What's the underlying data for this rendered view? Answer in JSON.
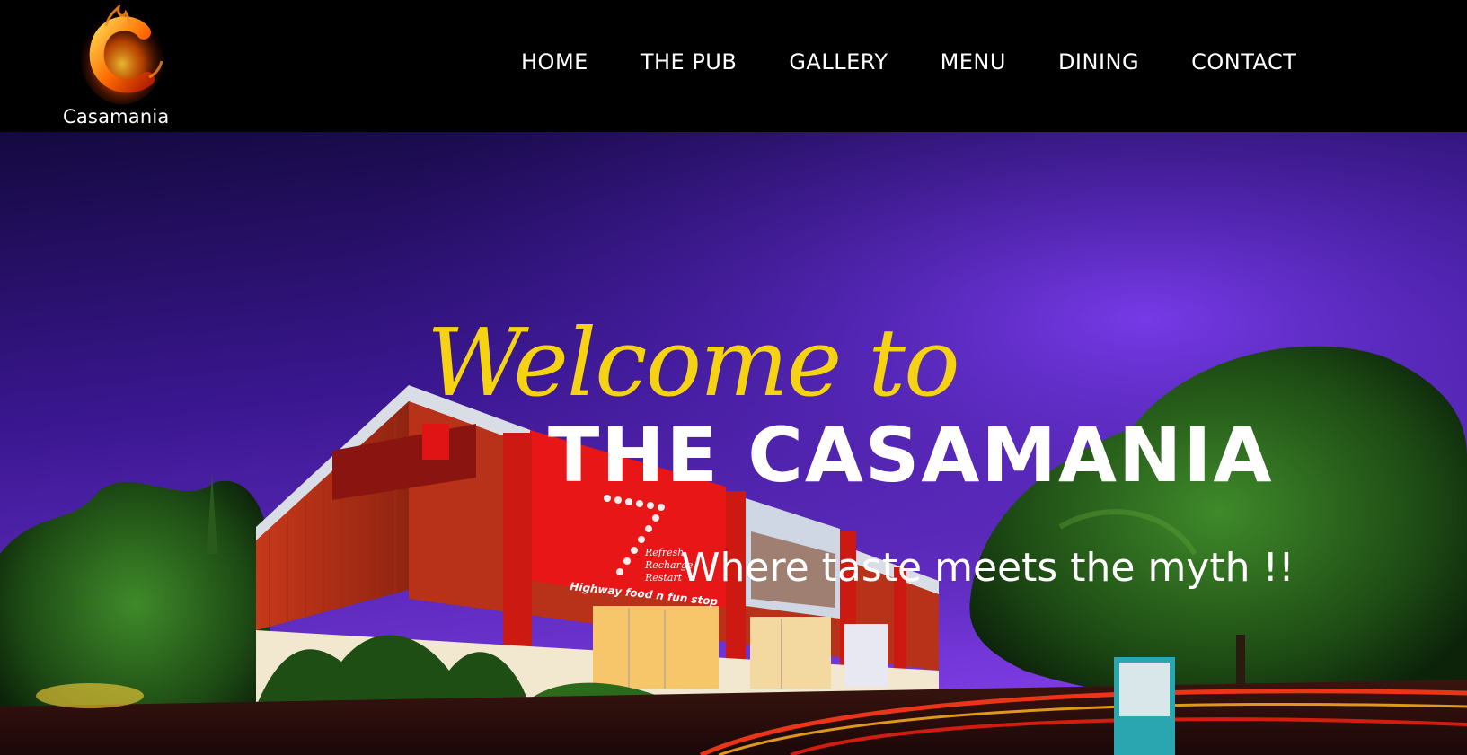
{
  "header": {
    "logo_text": "Casamania",
    "nav": [
      "HOME",
      "THE PUB",
      "GALLERY",
      "MENU",
      "DINING",
      "CONTACT"
    ]
  },
  "hero": {
    "welcome": "Welcome to",
    "brand": "THE CASAMANIA",
    "tagline": "Where taste meets the myth !!",
    "sign_number": "7",
    "sign_lines": [
      "Refresh",
      "Recharge",
      "Restart"
    ],
    "sign_footer": "Highway food n fun stop"
  },
  "colors": {
    "header_bg": "#000000",
    "welcome_yellow": "#f5d312",
    "sky_top": "#1a0a55",
    "sky_bottom": "#6b2ad8",
    "building_red": "#e01414"
  }
}
